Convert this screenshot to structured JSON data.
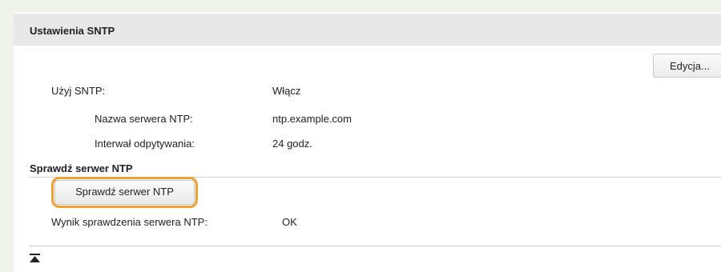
{
  "section": {
    "title": "Ustawienia SNTP",
    "edit_label": "Edycja..."
  },
  "settings": {
    "use_sntp_label": "Użyj SNTP:",
    "use_sntp_value": "Włącz",
    "server_name_label": "Nazwa serwera NTP:",
    "server_name_value": "ntp.example.com",
    "interval_label": "Interwał odpytywania:",
    "interval_value": "24 godz."
  },
  "check": {
    "title": "Sprawdź serwer NTP",
    "button_label": "Sprawdź serwer NTP",
    "highlight_color": "#f0a030",
    "result_label": "Wynik sprawdzenia serwera NTP:",
    "result_value": "OK"
  },
  "icons": {
    "back_to_top": "back-to-top-icon"
  }
}
